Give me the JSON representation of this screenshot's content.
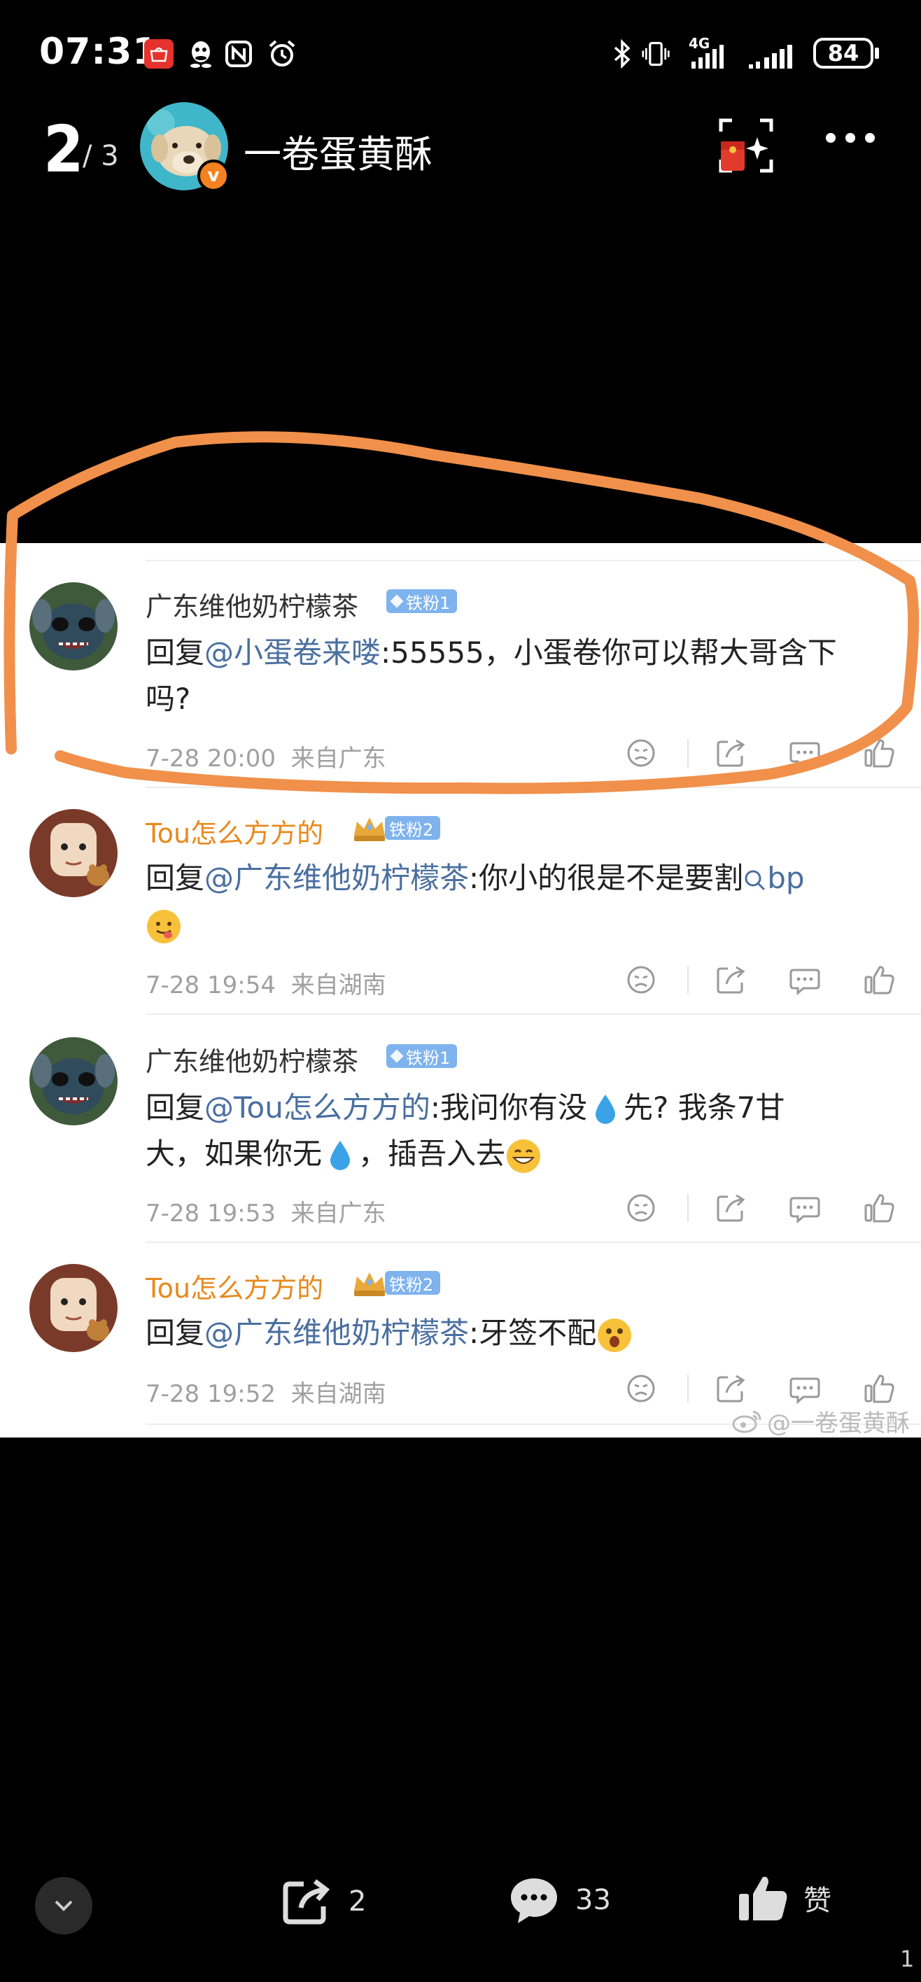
{
  "status_bar": {
    "time": "07:31",
    "battery": "84",
    "network": "4G",
    "icons": [
      "huawei-store-icon",
      "qq-icon",
      "nfc-icon",
      "alarm-icon",
      "bluetooth-icon",
      "vibrate-icon",
      "signal-4g-icon",
      "signal-icon",
      "battery-icon"
    ]
  },
  "header": {
    "page_current": "2",
    "page_total": "/ 3",
    "user_name": "一卷蛋黄酥",
    "verified_mark": "v"
  },
  "comments": [
    {
      "user": "广东维他奶柠檬茶",
      "user_color": "#333333",
      "badge": "铁粉1",
      "badge_type": "gem",
      "prefix": "回复",
      "mention": "@小蛋卷来喽",
      "text_line1_rest": ":55555，小蛋卷你可以帮大哥含下",
      "text_line2": "吗?",
      "time": "7-28 20:00",
      "location": "来自广东"
    },
    {
      "user": "Tou怎么方方的",
      "user_color": "#e8891c",
      "badge": "铁粉2",
      "badge_type": "crown",
      "prefix": "回复",
      "mention": "@广东维他奶柠檬茶",
      "text_line1_rest": ":你小的很是不是要割",
      "search_term": "bp",
      "time": "7-28 19:54",
      "location": "来自湖南"
    },
    {
      "user": "广东维他奶柠檬茶",
      "user_color": "#333333",
      "badge": "铁粉1",
      "badge_type": "gem",
      "prefix": "回复",
      "mention": "@Tou怎么方方的",
      "text_line1_rest": ":我问你有没",
      "text_line1_tail": "先? 我条7甘",
      "text_line2_a": "大，如果你无",
      "text_line2_b": "，插吾入去",
      "time": "7-28 19:53",
      "location": "来自广东"
    },
    {
      "user": "Tou怎么方方的",
      "user_color": "#e8891c",
      "badge": "铁粉2",
      "badge_type": "crown",
      "prefix": "回复",
      "mention": "@广东维他奶柠檬茶",
      "text_line1_rest": ":牙签不配",
      "time": "7-28 19:52",
      "location": "来自湖南"
    }
  ],
  "watermark": "@一卷蛋黄酥",
  "bottom_bar": {
    "share_count": "2",
    "comment_count": "33",
    "like_label": "赞"
  },
  "corner_page_number": "1",
  "colors": {
    "annotation": "#f0904a",
    "mention": "#4a6fa0",
    "badge": "#7fb3ee",
    "orange_name": "#e8891c"
  }
}
